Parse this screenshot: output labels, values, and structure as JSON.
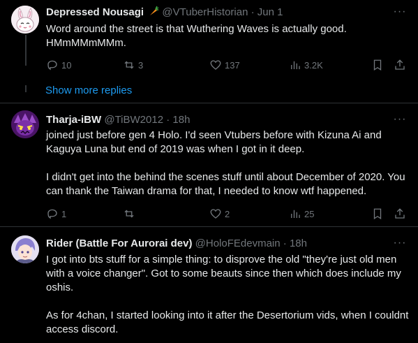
{
  "posts": [
    {
      "name": "Depressed Nousagi",
      "handle": "@VTuberHistorian",
      "time": "Jun 1",
      "dot": "·",
      "more": "···",
      "lines": [
        "Word around the street is that Wuthering Waves is actually good. HMmMMmMMm."
      ],
      "stats": {
        "replies": "10",
        "reposts": "3",
        "likes": "137",
        "views": "3.2K"
      }
    },
    {
      "name": "Tharja-iBW",
      "handle": "@TiBW2012",
      "time": "18h",
      "dot": "·",
      "more": "···",
      "lines": [
        "joined just before gen 4 Holo. I'd seen Vtubers before with Kizuna Ai and Kaguya Luna but end of 2019 was when I got in it deep.",
        "I didn't get into the behind the scenes stuff until about December of 2020. You can thank the Taiwan drama for that, I needed to know wtf happened."
      ],
      "stats": {
        "replies": "1",
        "reposts": "",
        "likes": "2",
        "views": "25"
      }
    },
    {
      "name": "Rider (Battle For Aurorai dev)",
      "handle": "@HoloFEdevmain",
      "time": "18h",
      "dot": "·",
      "more": "···",
      "lines": [
        "I got into bts stuff for a simple thing: to disprove the old \"they're just old men with a voice changer\". Got to some beauts since then which does include my oshis.",
        "As for 4chan, I started looking into it after the Desertorium vids, when I couldnt access discord."
      ]
    }
  ],
  "show_more": "Show more replies",
  "colors": {
    "bg": "#000000",
    "text": "#e7e9ea",
    "muted": "#71767b",
    "link": "#1d9bf0"
  }
}
